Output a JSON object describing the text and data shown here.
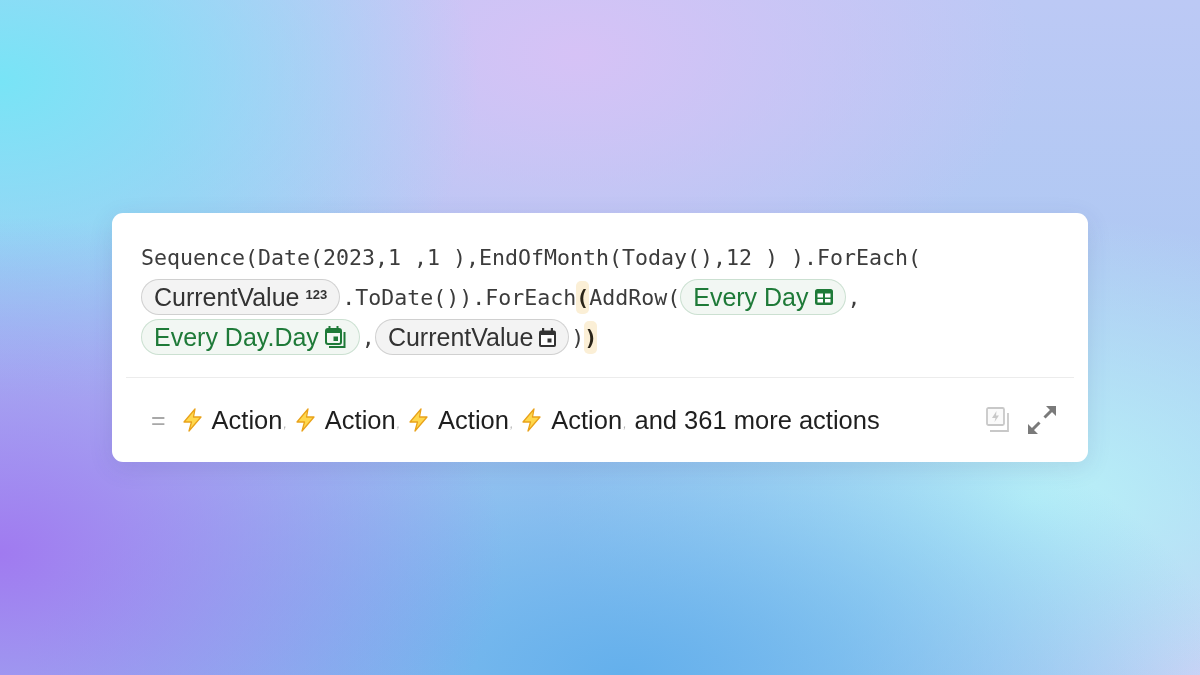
{
  "formula": {
    "lines": [
      {
        "tokens": [
          {
            "kind": "code",
            "text": "Sequence(Date(2023,1 ,1 ),EndOfMonth(Today(),12 ) ).ForEach("
          }
        ]
      },
      {
        "tokens": [
          {
            "kind": "chip",
            "color": "#333333",
            "text": "CurrentValue",
            "type_label": "123"
          },
          {
            "kind": "code",
            "text": ".ToDate()).ForEach"
          },
          {
            "kind": "bracket",
            "text": "(",
            "highlighted": true
          },
          {
            "kind": "code",
            "text": "AddRow("
          },
          {
            "kind": "chip",
            "color": "#1e7a38",
            "text": "Every Day"
          },
          {
            "kind": "code",
            "text": ","
          }
        ]
      },
      {
        "tokens": [
          {
            "kind": "chip",
            "color": "#1e7a38",
            "text": "Every Day.Day"
          },
          {
            "kind": "code",
            "text": ","
          },
          {
            "kind": "chip",
            "color": "#333333",
            "text": "CurrentValue"
          },
          {
            "kind": "code",
            "text": ")"
          },
          {
            "kind": "bracket",
            "text": ")",
            "highlighted": true
          }
        ]
      }
    ]
  },
  "result": {
    "prefix": "=",
    "items": [
      {
        "label": "Action",
        "separator": ","
      },
      {
        "label": "Action",
        "separator": ","
      },
      {
        "label": "Action",
        "separator": ","
      },
      {
        "label": "Action",
        "separator": ","
      }
    ],
    "more": "and 361 more actions"
  },
  "toolbar": [
    {
      "kind": "actions",
      "disabled": true
    },
    {
      "kind": "expand",
      "disabled": false
    }
  ]
}
